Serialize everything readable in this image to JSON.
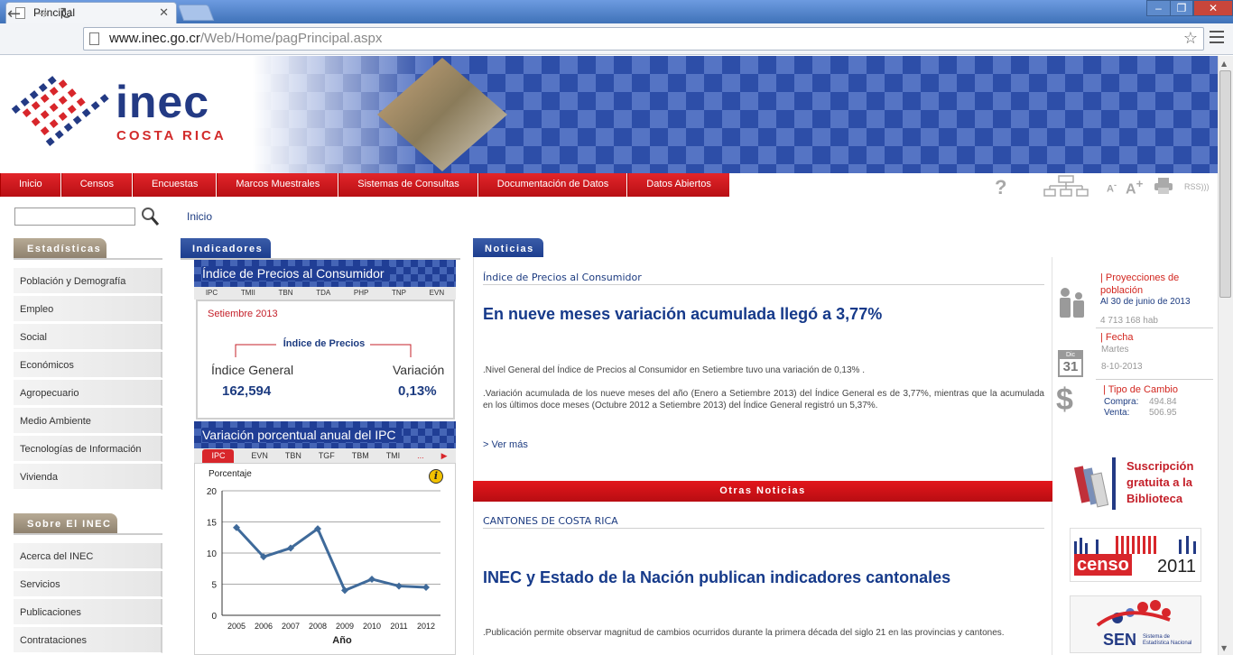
{
  "browser": {
    "tab_title": "Principal",
    "url_host": "www.inec.go.cr",
    "url_path": "/Web/Home/pagPrincipal.aspx"
  },
  "logo": {
    "name": "inec",
    "country": "COSTA RICA"
  },
  "nav": [
    "Inicio",
    "Censos",
    "Encuestas",
    "Marcos Muestrales",
    "Sistemas de Consultas",
    "Documentación de Datos",
    "Datos Abiertos"
  ],
  "tools": {
    "help": "?",
    "font_small": "A",
    "font_large": "A",
    "rss": "RSS"
  },
  "breadcrumb": "Inicio",
  "sidebar": {
    "estadisticas_title": "Estadísticas",
    "estadisticas": [
      "Población y Demografía",
      "Empleo",
      "Social",
      "Económicos",
      "Agropecuario",
      "Medio Ambiente",
      "Tecnologías de Información",
      "Vivienda"
    ],
    "sobre_title": "Sobre El INEC",
    "sobre": [
      "Acerca del INEC",
      "Servicios",
      "Publicaciones",
      "Contrataciones"
    ]
  },
  "indicadores": {
    "tab": "Indicadores",
    "ipc_title": "Índice de Precios al Consumidor",
    "tabs": [
      "IPC",
      "TMII",
      "TBN",
      "TDA",
      "PHP",
      "TNP",
      "EVN"
    ],
    "period": "Setiembre 2013",
    "index_label": "Índice de Precios",
    "general_label": "Índice General",
    "general_value": "162,594",
    "variation_label": "Variación",
    "variation_value": "0,13%",
    "chart_title": "Variación porcentual anual del IPC",
    "chart_tabs": [
      "IPC",
      "EVN",
      "TBN",
      "TGF",
      "TBM",
      "TMI",
      "..."
    ],
    "info_icon": "i"
  },
  "chart_data": {
    "type": "line",
    "x": [
      2005,
      2006,
      2007,
      2008,
      2009,
      2010,
      2011,
      2012
    ],
    "series": [
      {
        "values": [
          14.1,
          9.4,
          10.8,
          13.9,
          4.0,
          5.8,
          4.7,
          4.5
        ]
      }
    ],
    "ylabel": "Porcentaje",
    "xlabel": "Año",
    "ylim": [
      0,
      20
    ],
    "yticks": [
      0,
      5,
      10,
      15,
      20
    ],
    "grid": true,
    "color": "#3f6a9a"
  },
  "noticias": {
    "tab": "Noticias",
    "category": "Índice de Precios al Consumidor",
    "headline": "En nueve meses variación acumulada llegó a 3,77%",
    "para1": ".Nivel General del Índice de Precios al Consumidor en Setiembre tuvo una variación de 0,13% .",
    "para2": ".Variación acumulada de los nueve meses del año (Enero a Setiembre 2013) del Índice General es de 3,77%, mientras que la acumulada en los últimos doce meses (Octubre 2012 a Setiembre 2013) del Índice General registró un 5,37%.",
    "more": "> Ver más",
    "otras_title": "Otras Noticias",
    "category2": "CANTONES DE COSTA RICA",
    "headline2": "INEC y Estado de la Nación publican indicadores cantonales",
    "para3": ".Publicación permite observar magnitud de cambios ocurridos durante la primera década del siglo 21 en las provincias y cantones."
  },
  "right": {
    "proy_title": "| Proyecciones de población",
    "proy_date": "Al 30 de junio de 2013",
    "proy_value": "4 713 168 hab",
    "fecha_title": "| Fecha",
    "fecha_day": "Martes",
    "fecha_date": "8-10-2013",
    "cal_month": "Dic",
    "cal_day": "31",
    "tc_title": "| Tipo de Cambio",
    "compra_label": "Compra:",
    "compra_value": "494.84",
    "venta_label": "Venta:",
    "venta_value": "506.95",
    "lib_text": "Suscripción gratuita a la Biblioteca",
    "censo_text": "censo",
    "censo_year": "2011",
    "sen_text": "SEN",
    "sen_sub": "Sistema de Estadística Nacional"
  }
}
